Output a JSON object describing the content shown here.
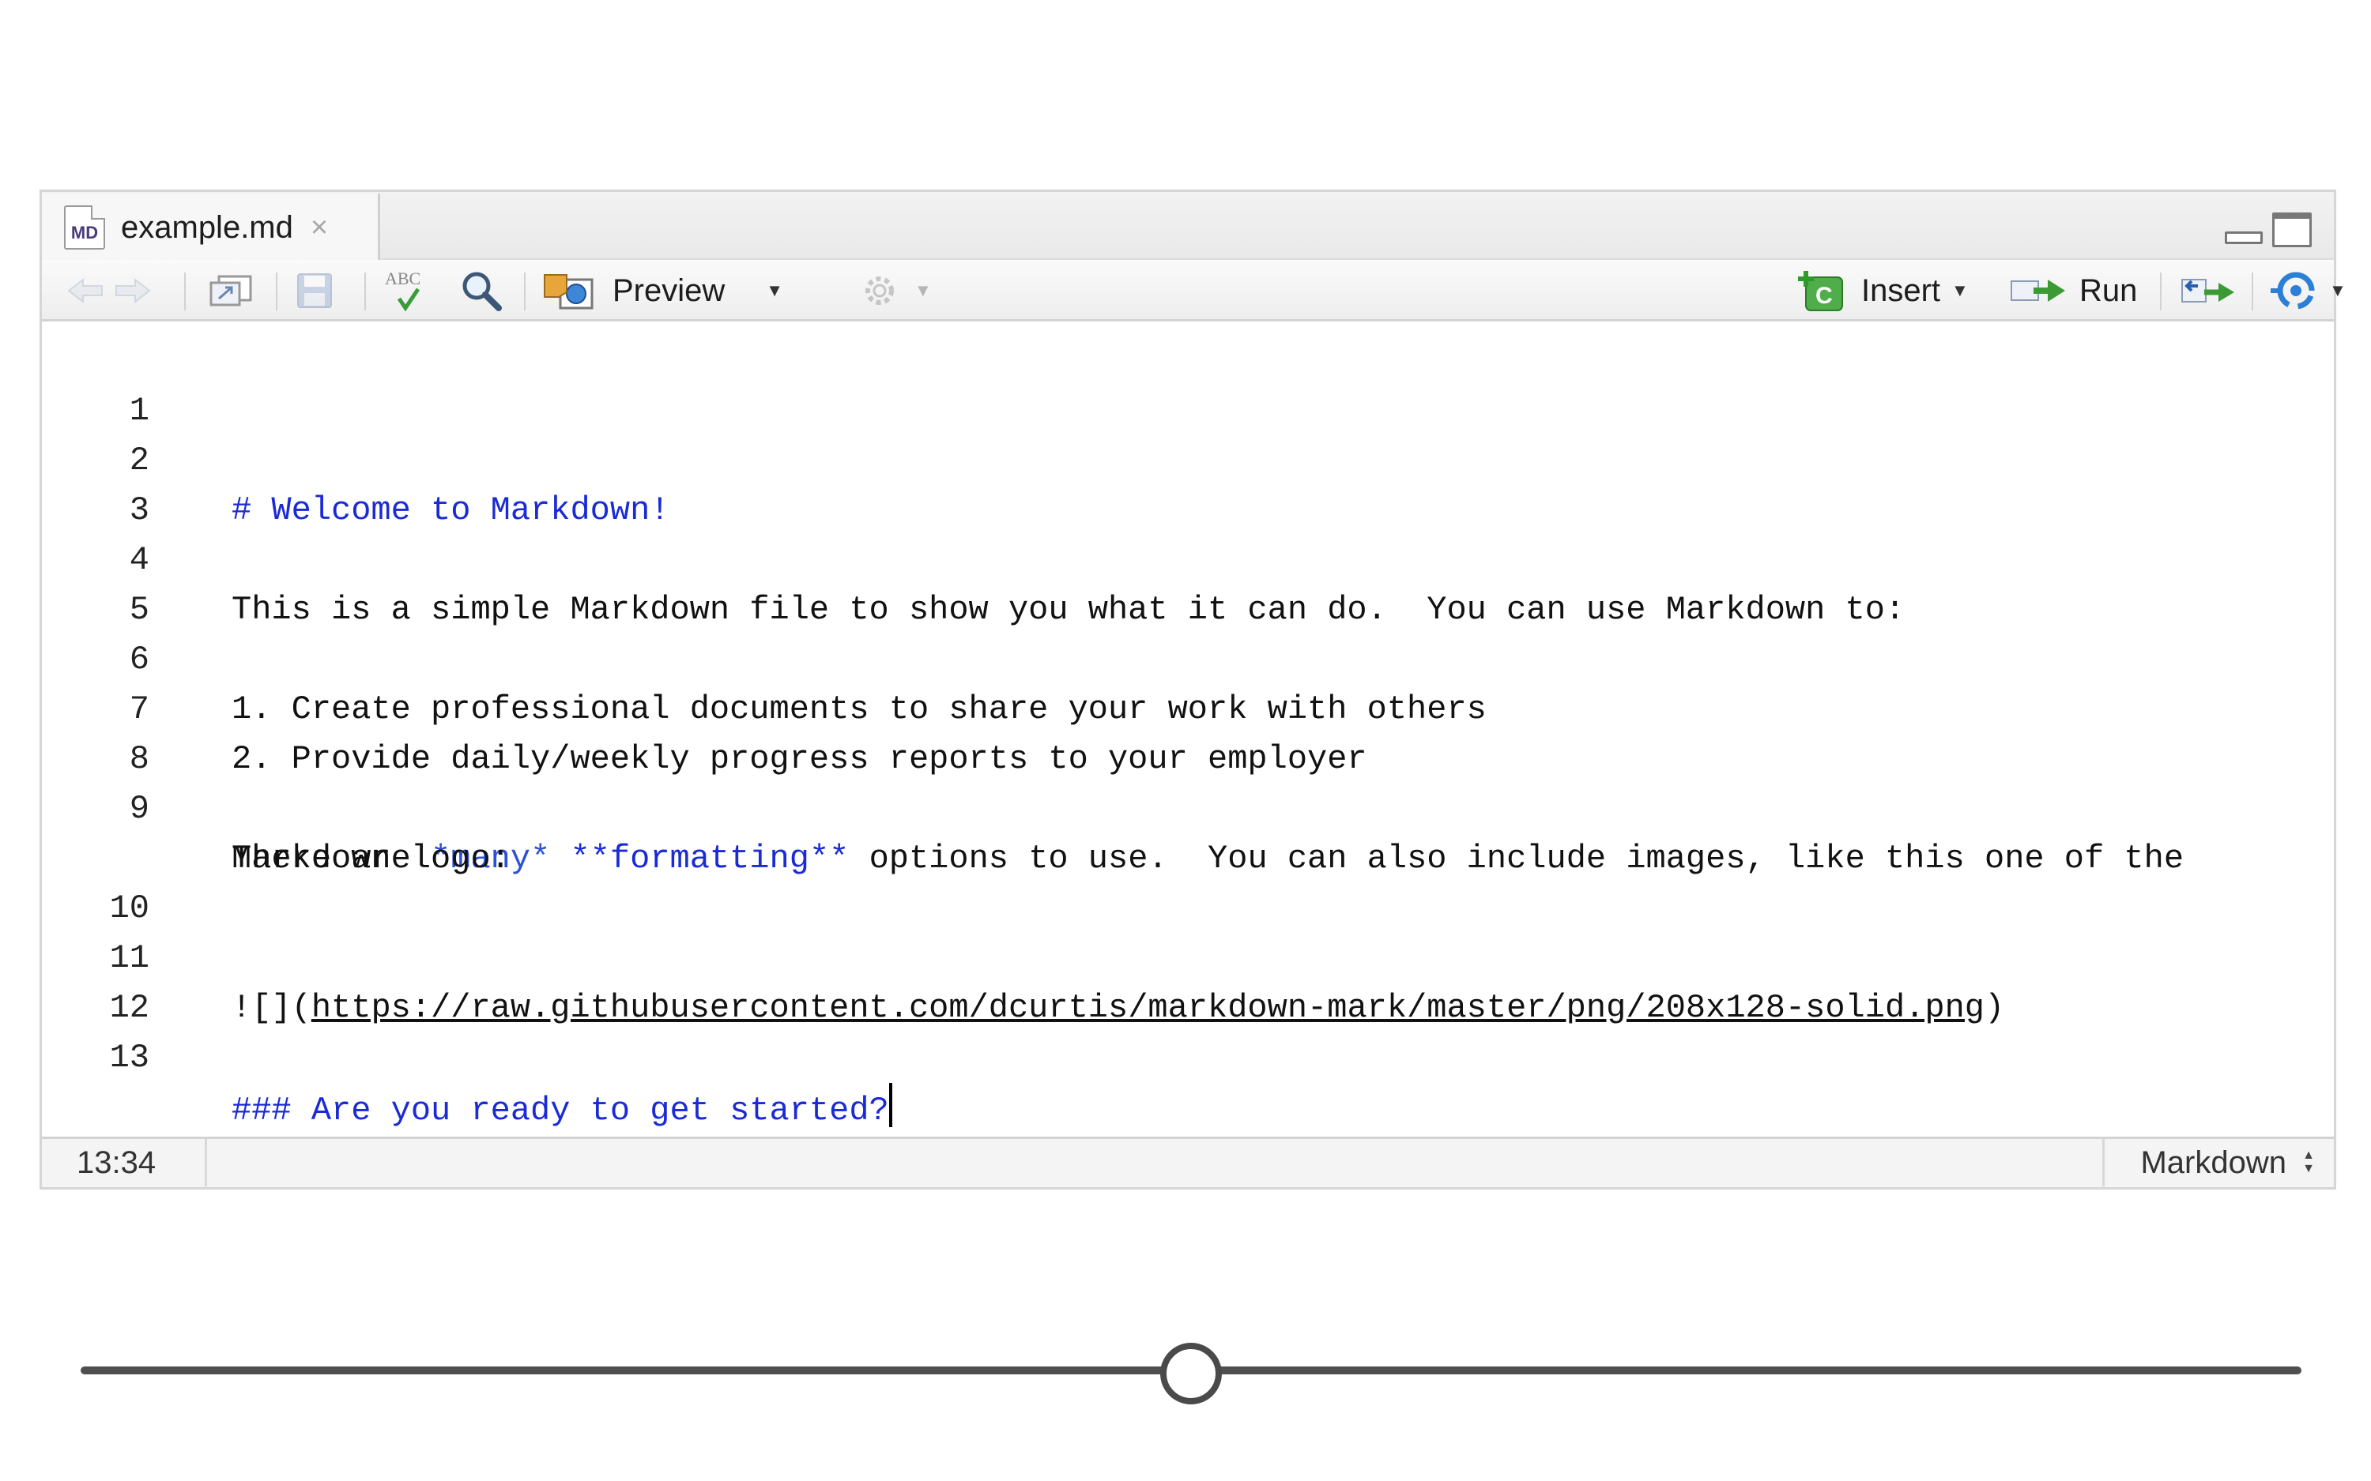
{
  "tab": {
    "icon_text": "MD",
    "title": "example.md",
    "close_symbol": "×"
  },
  "toolbar": {
    "preview_label": "Preview",
    "insert_label": "Insert",
    "insert_icon_text": "C",
    "run_label": "Run",
    "spellcheck_icon_text": "ABC"
  },
  "lines": [
    {
      "number": "1",
      "text": ""
    },
    {
      "number": "2",
      "text": "# Welcome to Markdown!"
    },
    {
      "number": "3",
      "text": ""
    },
    {
      "number": "4",
      "text": "This is a simple Markdown file to show you what it can do.  You can use Markdown to:"
    },
    {
      "number": "5",
      "text": ""
    },
    {
      "number": "6",
      "text": "1. Create professional documents to share your work with others"
    },
    {
      "number": "7",
      "text": "2. Provide daily/weekly progress reports to your employer"
    },
    {
      "number": "8",
      "text": ""
    },
    {
      "number": "9",
      "text_before": "There are ",
      "em": "*many*",
      "strong": "**formatting**",
      "text_after": " options to use.  You can also include images, like this one of the",
      "wrap": "Markdown logo:"
    },
    {
      "number": "10",
      "text": ""
    },
    {
      "number": "11",
      "prefix": "![](",
      "url": "https://raw.githubusercontent.com/dcurtis/markdown-mark/master/png/208x128-solid.png",
      "suffix": ")"
    },
    {
      "number": "12",
      "text": ""
    },
    {
      "number": "13",
      "text": "### Are you ready to get started?"
    }
  ],
  "status": {
    "cursor_position": "13:34",
    "mode": "Markdown"
  },
  "slider": {
    "value_fraction": 0.5
  },
  "colors": {
    "heading": "#1a2ad6",
    "emphasis": "#2b4fd8",
    "gutter": "#eeeeee"
  }
}
